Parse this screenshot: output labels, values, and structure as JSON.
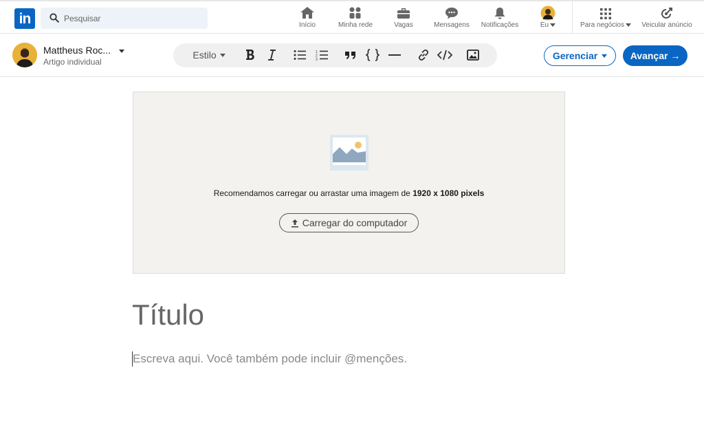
{
  "nav": {
    "logo_text": "in",
    "search_placeholder": "Pesquisar",
    "items": [
      {
        "label": "Início",
        "icon": "home-icon"
      },
      {
        "label": "Minha rede",
        "icon": "network-icon"
      },
      {
        "label": "Vagas",
        "icon": "briefcase-icon"
      },
      {
        "label": "Mensagens",
        "icon": "messaging-icon"
      },
      {
        "label": "Notificações",
        "icon": "bell-icon"
      },
      {
        "label": "Eu",
        "icon": "me-avatar"
      },
      {
        "label": "Para negócios",
        "icon": "grid-icon"
      },
      {
        "label": "Veicular anúncio",
        "icon": "advertise-icon"
      }
    ]
  },
  "editor": {
    "author_name": "Mattheus Roc...",
    "author_subtitle": "Artigo individual",
    "style_label": "Estilo",
    "manage_label": "Gerenciar",
    "next_label": "Avançar →"
  },
  "cover": {
    "text_prefix": "Recomendamos carregar ou arrastar uma imagem de ",
    "text_bold": "1920 x 1080 pixels",
    "upload_label": "Carregar do computador"
  },
  "article": {
    "title_placeholder": "Título",
    "body_placeholder": "Escreva aqui. Você também pode incluir @menções."
  },
  "colors": {
    "brand": "#0a66c2",
    "cover_bg": "#f3f2ef"
  }
}
